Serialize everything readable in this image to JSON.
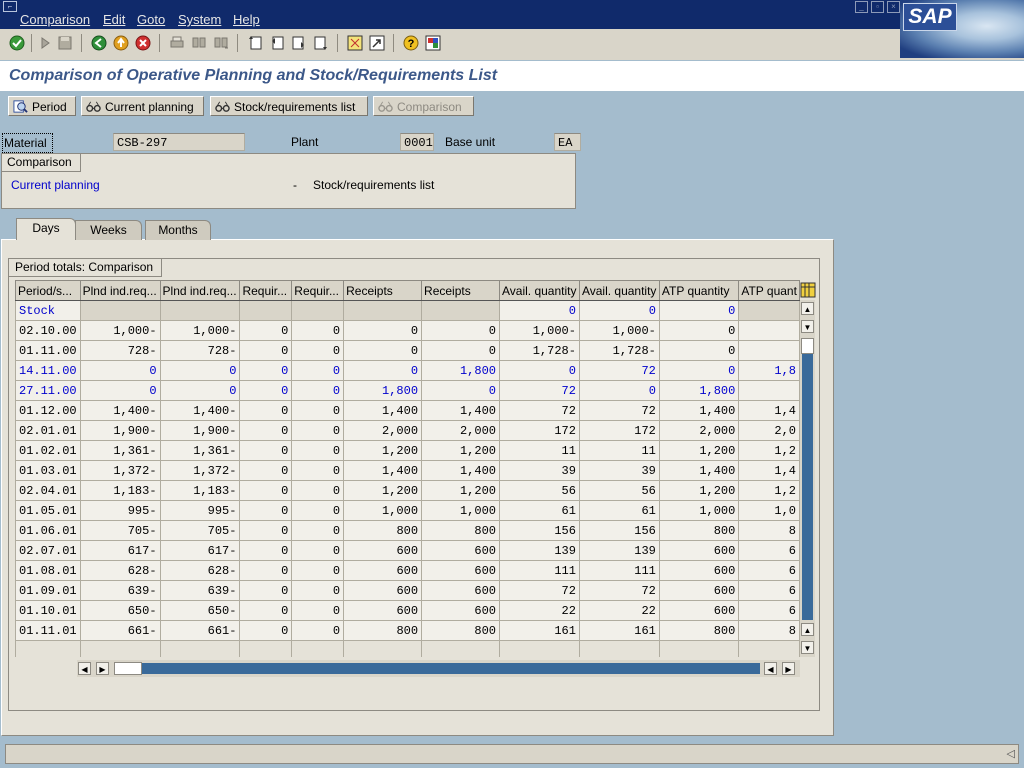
{
  "menu": [
    "Comparison",
    "Edit",
    "Goto",
    "System",
    "Help"
  ],
  "logo": "SAP",
  "title": "Comparison of Operative Planning and Stock/Requirements List",
  "app_buttons": {
    "period": "Period",
    "current_planning": "Current planning",
    "stock_req": "Stock/requirements list",
    "comparison": "Comparison"
  },
  "header": {
    "material_label": "Material",
    "material_value": "CSB-297",
    "plant_label": "Plant",
    "plant_value": "0001",
    "base_unit_label": "Base unit",
    "base_unit_value": "EA"
  },
  "comparison_box": {
    "title": "Comparison",
    "left": "Current planning",
    "dash": "-",
    "right": "Stock/requirements list"
  },
  "tabs": [
    "Days",
    "Weeks",
    "Months"
  ],
  "totals_title": "Period totals: Comparison",
  "table": {
    "columns": [
      "Period/s...",
      "Plnd ind.req...",
      "Plnd ind.req...",
      "Requir...",
      "Requir...",
      "Receipts",
      "Receipts",
      "Avail. quantity",
      "Avail. quantity",
      "ATP quantity",
      "ATP quant"
    ],
    "stock_row": [
      "Stock",
      "",
      "",
      "",
      "",
      "",
      "",
      "0",
      "0",
      "0",
      ""
    ],
    "rows": [
      {
        "blue": false,
        "cells": [
          "02.10.00",
          "1,000-",
          "1,000-",
          "0",
          "0",
          "0",
          "0",
          "1,000-",
          "1,000-",
          "0",
          ""
        ]
      },
      {
        "blue": false,
        "cells": [
          "01.11.00",
          "728-",
          "728-",
          "0",
          "0",
          "0",
          "0",
          "1,728-",
          "1,728-",
          "0",
          ""
        ]
      },
      {
        "blue": true,
        "cells": [
          "14.11.00",
          "0",
          "0",
          "0",
          "0",
          "0",
          "1,800",
          "0",
          "72",
          "0",
          "1,8"
        ]
      },
      {
        "blue": true,
        "cells": [
          "27.11.00",
          "0",
          "0",
          "0",
          "0",
          "1,800",
          "0",
          "72",
          "0",
          "1,800",
          ""
        ]
      },
      {
        "blue": false,
        "cells": [
          "01.12.00",
          "1,400-",
          "1,400-",
          "0",
          "0",
          "1,400",
          "1,400",
          "72",
          "72",
          "1,400",
          "1,4"
        ]
      },
      {
        "blue": false,
        "cells": [
          "02.01.01",
          "1,900-",
          "1,900-",
          "0",
          "0",
          "2,000",
          "2,000",
          "172",
          "172",
          "2,000",
          "2,0"
        ]
      },
      {
        "blue": false,
        "cells": [
          "01.02.01",
          "1,361-",
          "1,361-",
          "0",
          "0",
          "1,200",
          "1,200",
          "11",
          "11",
          "1,200",
          "1,2"
        ]
      },
      {
        "blue": false,
        "cells": [
          "01.03.01",
          "1,372-",
          "1,372-",
          "0",
          "0",
          "1,400",
          "1,400",
          "39",
          "39",
          "1,400",
          "1,4"
        ]
      },
      {
        "blue": false,
        "cells": [
          "02.04.01",
          "1,183-",
          "1,183-",
          "0",
          "0",
          "1,200",
          "1,200",
          "56",
          "56",
          "1,200",
          "1,2"
        ]
      },
      {
        "blue": false,
        "cells": [
          "01.05.01",
          "995-",
          "995-",
          "0",
          "0",
          "1,000",
          "1,000",
          "61",
          "61",
          "1,000",
          "1,0"
        ]
      },
      {
        "blue": false,
        "cells": [
          "01.06.01",
          "705-",
          "705-",
          "0",
          "0",
          "800",
          "800",
          "156",
          "156",
          "800",
          "8"
        ]
      },
      {
        "blue": false,
        "cells": [
          "02.07.01",
          "617-",
          "617-",
          "0",
          "0",
          "600",
          "600",
          "139",
          "139",
          "600",
          "6"
        ]
      },
      {
        "blue": false,
        "cells": [
          "01.08.01",
          "628-",
          "628-",
          "0",
          "0",
          "600",
          "600",
          "111",
          "111",
          "600",
          "6"
        ]
      },
      {
        "blue": false,
        "cells": [
          "01.09.01",
          "639-",
          "639-",
          "0",
          "0",
          "600",
          "600",
          "72",
          "72",
          "600",
          "6"
        ]
      },
      {
        "blue": false,
        "cells": [
          "01.10.01",
          "650-",
          "650-",
          "0",
          "0",
          "600",
          "600",
          "22",
          "22",
          "600",
          "6"
        ]
      },
      {
        "blue": false,
        "cells": [
          "01.11.01",
          "661-",
          "661-",
          "0",
          "0",
          "800",
          "800",
          "161",
          "161",
          "800",
          "8"
        ]
      }
    ]
  },
  "colors": {
    "title_bar": "#102a6b",
    "title_text": "#3c5889",
    "background": "#a4bccd",
    "link_blue": "#0000cc"
  },
  "icons": [
    "checkmark-icon",
    "play-icon",
    "save-icon",
    "back-icon",
    "exit-icon",
    "cancel-icon",
    "print-icon",
    "find-icon",
    "find-next-icon",
    "first-page-icon",
    "previous-page-icon",
    "next-page-icon",
    "last-page-icon",
    "create-session-icon",
    "shortcut-icon",
    "help-icon",
    "layout-icon"
  ]
}
